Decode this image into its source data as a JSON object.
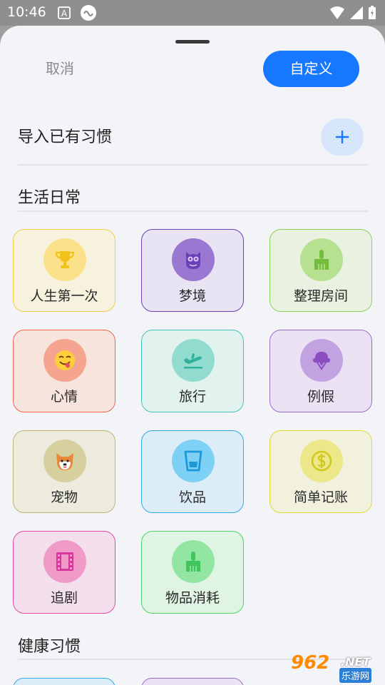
{
  "status_bar": {
    "time": "10:46"
  },
  "header": {
    "cancel_label": "取消",
    "custom_label": "自定义"
  },
  "import": {
    "title": "导入已有习惯"
  },
  "sections": {
    "daily": {
      "title": "生活日常"
    },
    "health": {
      "title": "健康习惯"
    }
  },
  "habits": [
    {
      "label": "人生第一次",
      "icon": "trophy-icon",
      "accent": "#f5c518"
    },
    {
      "label": "梦境",
      "icon": "owl-icon",
      "accent": "#7b4cc4"
    },
    {
      "label": "整理房间",
      "icon": "broom-icon",
      "accent": "#7cc043"
    },
    {
      "label": "心情",
      "icon": "smile-emoji-icon",
      "accent": "#f06a4a"
    },
    {
      "label": "旅行",
      "icon": "airplane-departure-icon",
      "accent": "#3dbfae"
    },
    {
      "label": "例假",
      "icon": "ice-cream-icon",
      "accent": "#9a6cc9"
    },
    {
      "label": "宠物",
      "icon": "dog-emoji-icon",
      "accent": "#c4ba7a"
    },
    {
      "label": "饮品",
      "icon": "cup-icon",
      "accent": "#2fa8e6"
    },
    {
      "label": "简单记账",
      "icon": "dollar-coin-icon",
      "accent": "#e1d83a"
    },
    {
      "label": "追剧",
      "icon": "film-icon",
      "accent": "#e24aa6"
    },
    {
      "label": "物品消耗",
      "icon": "broom-icon",
      "accent": "#4fd36a"
    }
  ],
  "watermark": {
    "number": "962",
    "domain": ".NET",
    "name": "乐游网"
  }
}
